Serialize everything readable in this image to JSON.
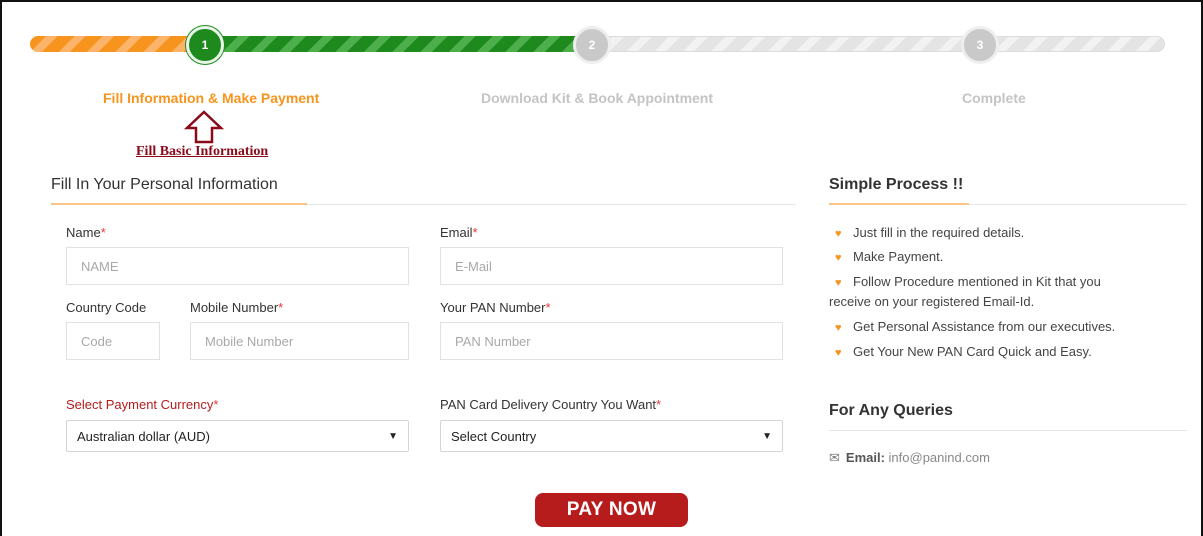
{
  "steps": [
    {
      "number": "1",
      "label": "Fill Information & Make Payment"
    },
    {
      "number": "2",
      "label": "Download Kit & Book Appointment"
    },
    {
      "number": "3",
      "label": "Complete"
    }
  ],
  "annotation": "Fill Basic Information",
  "form": {
    "title": "Fill In Your Personal Information",
    "name_label": "Name",
    "name_placeholder": "NAME",
    "email_label": "Email",
    "email_placeholder": "E-Mail",
    "country_code_label": "Country Code",
    "country_code_placeholder": "Code",
    "mobile_label": "Mobile Number",
    "mobile_placeholder": "Mobile Number",
    "pan_label": "Your PAN Number",
    "pan_placeholder": "PAN Number",
    "currency_label": "Select Payment Currency",
    "currency_value": "Australian dollar (AUD)",
    "delivery_label": "PAN Card Delivery Country You Want",
    "delivery_value": "Select Country",
    "required_mark": "*",
    "pay_button": "PAY NOW"
  },
  "side": {
    "process_title": "Simple Process !!",
    "process_items": [
      "Just fill in the required details.",
      "Make Payment.",
      "Follow Procedure mentioned in Kit that you",
      "receive on your registered Email-Id.",
      "Get Personal Assistance from our executives.",
      "Get Your New PAN Card Quick and Easy."
    ],
    "queries_title": "For Any Queries",
    "email_label": "Email:",
    "email_value": "info@panind.com"
  },
  "colors": {
    "accent_orange": "#f7941d",
    "step_green": "#1e8a1e",
    "pay_red": "#b71c1c",
    "annotation_red": "#8b0a1a"
  }
}
